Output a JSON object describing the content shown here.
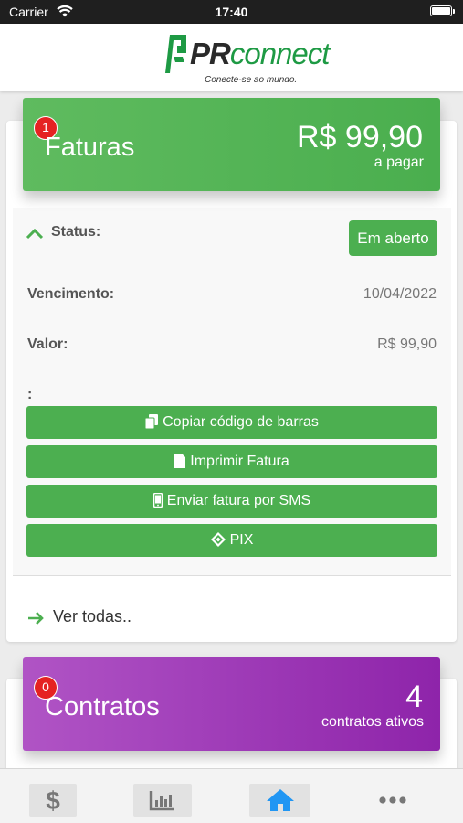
{
  "status_bar": {
    "carrier": "Carrier",
    "time": "17:40"
  },
  "header": {
    "logo_pr": "PR",
    "logo_connect": "connect",
    "slogan": "Conecte-se ao mundo."
  },
  "faturas": {
    "badge_count": "1",
    "title": "Faturas",
    "amount": "R$ 99,90",
    "amount_caption": "a pagar",
    "status_label": "Status:",
    "status_value": "Em aberto",
    "vencimento_label": "Vencimento:",
    "vencimento_value": "10/04/2022",
    "valor_label": "Valor:",
    "valor_value": "R$ 99,90",
    "extra_label": ":",
    "buttons": [
      {
        "label": "Copiar código de barras",
        "icon": "copy-icon"
      },
      {
        "label": "Imprimir Fatura",
        "icon": "file-icon"
      },
      {
        "label": "Enviar fatura por SMS",
        "icon": "mobile-icon"
      },
      {
        "label": "PIX",
        "icon": "pix-icon"
      }
    ],
    "see_all": "Ver todas.."
  },
  "contratos": {
    "badge_count": "0",
    "title": "Contratos",
    "count": "4",
    "count_caption": "contratos ativos"
  },
  "tabbar": [
    {
      "icon": "dollar-icon",
      "active": false
    },
    {
      "icon": "chart-icon",
      "active": false
    },
    {
      "icon": "home-icon",
      "active": true
    },
    {
      "icon": "more-icon",
      "active": false
    }
  ],
  "colors": {
    "green": "#4caf50",
    "purple": "#9c27b0",
    "badge_red": "#e52222",
    "active_tab": "#2196f3"
  }
}
